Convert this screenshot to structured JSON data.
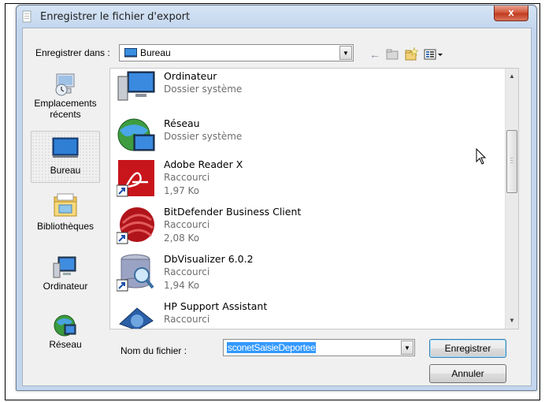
{
  "window": {
    "title": "Enregistrer le fichier d'export",
    "close_label": "x"
  },
  "toolbar": {
    "save_in_label": "Enregistrer dans :",
    "location": "Bureau",
    "icons": [
      "back-arrow-icon",
      "up-folder-icon",
      "new-folder-icon",
      "view-menu-icon"
    ]
  },
  "places": [
    {
      "label": "Emplacements récents",
      "icon": "recent-places-icon"
    },
    {
      "label": "Bureau",
      "icon": "desktop-icon",
      "selected": true
    },
    {
      "label": "Bibliothèques",
      "icon": "libraries-icon"
    },
    {
      "label": "Ordinateur",
      "icon": "computer-icon"
    },
    {
      "label": "Réseau",
      "icon": "network-icon"
    }
  ],
  "files": [
    {
      "name": "Ordinateur",
      "type": "Dossier système",
      "icon": "computer-icon"
    },
    {
      "name": "Réseau",
      "type": "Dossier système",
      "icon": "network-icon"
    },
    {
      "name": "Adobe Reader X",
      "type": "Raccourci",
      "size": "1,97 Ko",
      "icon": "adobe-reader-icon"
    },
    {
      "name": "BitDefender Business Client",
      "type": "Raccourci",
      "size": "2,08 Ko",
      "icon": "bitdefender-icon"
    },
    {
      "name": "DbVisualizer 6.0.2",
      "type": "Raccourci",
      "size": "1,94 Ko",
      "icon": "dbvisualizer-icon"
    },
    {
      "name": "HP Support Assistant",
      "type": "Raccourci",
      "icon": "hp-support-icon"
    }
  ],
  "filename": {
    "label": "Nom du fichier :",
    "value": "sconetSaisieDeportee"
  },
  "buttons": {
    "save": "Enregistrer",
    "cancel": "Annuler"
  },
  "colors": {
    "selection": "#3399ff",
    "titlebar": "#c3d6ee",
    "close": "#c23b1f"
  }
}
